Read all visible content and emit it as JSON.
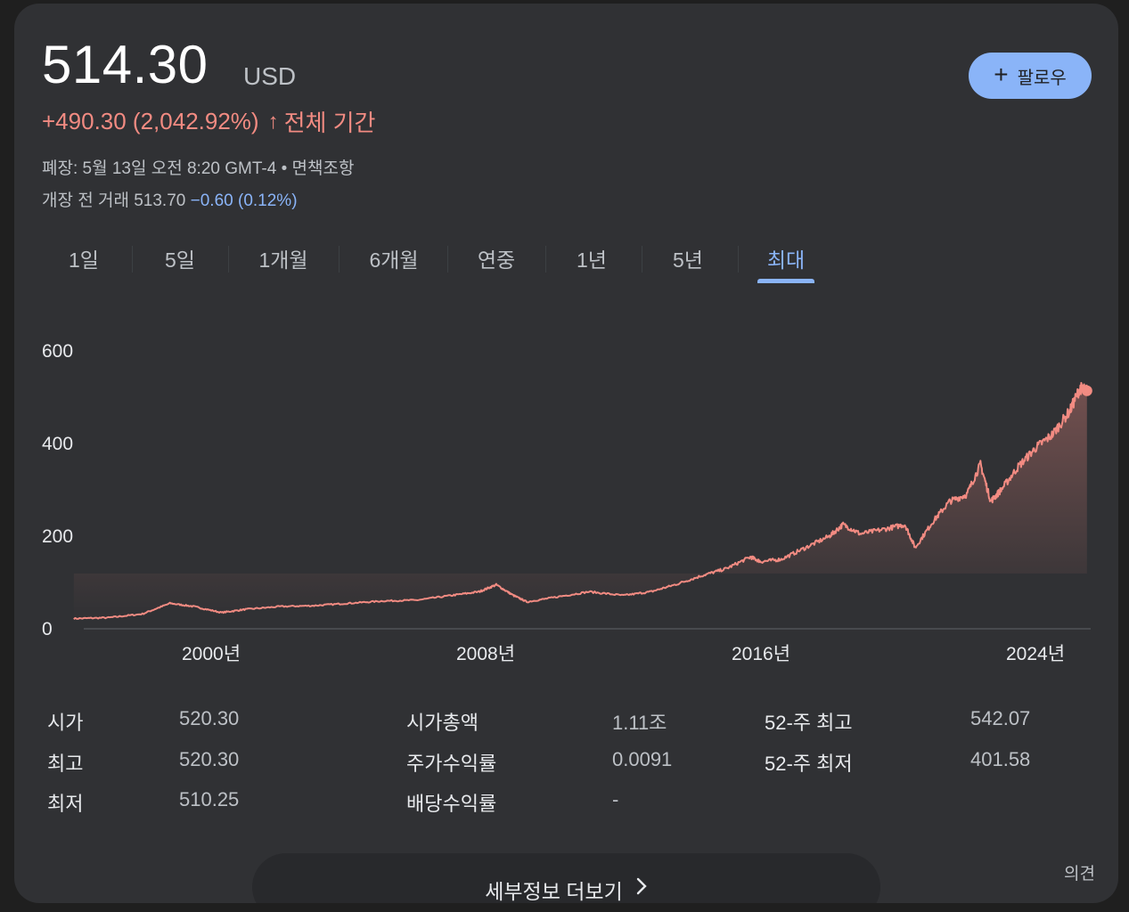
{
  "quote": {
    "price": "514.30",
    "currency": "USD",
    "change": "+490.30 (2,042.92%)",
    "change_arrow": "↑",
    "period_label": "전체 기간",
    "close_info": "폐장: 5월 13일 오전 8:20 GMT-4 • 면책조항",
    "premarket_label": "개장 전 거래 513.70",
    "premarket_change": "−0.60 (0.12%)"
  },
  "follow_button": {
    "icon": "plus-icon",
    "label": "팔로우"
  },
  "tabs": [
    {
      "label": "1일"
    },
    {
      "label": "5일"
    },
    {
      "label": "1개월"
    },
    {
      "label": "6개월"
    },
    {
      "label": "연중"
    },
    {
      "label": "1년"
    },
    {
      "label": "5년"
    },
    {
      "label": "최대",
      "active": true
    }
  ],
  "chart_data": {
    "type": "area",
    "color": "#f28b82",
    "ylim": [
      0,
      600
    ],
    "y_ticks": [
      "600",
      "400",
      "200",
      "0"
    ],
    "x_ticks": [
      "2000년",
      "2008년",
      "2016년",
      "2024년"
    ],
    "x": [
      1996.0,
      1997.0,
      1998.0,
      1998.8,
      1999.5,
      2000.3,
      2001.0,
      2002.0,
      2003.0,
      2004.0,
      2005.0,
      2006.0,
      2007.0,
      2007.8,
      2008.3,
      2008.8,
      2009.2,
      2010.0,
      2011.0,
      2012.0,
      2012.8,
      2013.5,
      2014.3,
      2015.0,
      2015.7,
      2016.0,
      2016.6,
      2017.3,
      2018.0,
      2018.4,
      2018.9,
      2019.6,
      2020.2,
      2020.5,
      2021.0,
      2021.5,
      2022.0,
      2022.4,
      2022.7,
      2023.0,
      2023.5,
      2024.0,
      2024.5,
      2025.0,
      2025.3,
      2025.5
    ],
    "y": [
      22,
      24,
      32,
      55,
      48,
      35,
      42,
      48,
      50,
      55,
      60,
      62,
      72,
      80,
      95,
      72,
      58,
      68,
      80,
      72,
      80,
      95,
      115,
      130,
      155,
      145,
      150,
      175,
      200,
      225,
      205,
      215,
      225,
      175,
      230,
      275,
      290,
      355,
      275,
      300,
      350,
      390,
      420,
      470,
      520,
      514
    ]
  },
  "stats": [
    {
      "label": "시가",
      "value": "520.30"
    },
    {
      "label": "최고",
      "value": "520.30"
    },
    {
      "label": "최저",
      "value": "510.25"
    },
    {
      "label": "시가총액",
      "value": "1.11조"
    },
    {
      "label": "주가수익률",
      "value": "0.0091"
    },
    {
      "label": "배당수익률",
      "value": "-"
    },
    {
      "label": "52-주 최고",
      "value": "542.07"
    },
    {
      "label": "52-주 최저",
      "value": "401.58"
    }
  ],
  "more_button": {
    "label": "세부정보 더보기",
    "icon": "chevron-right-icon"
  },
  "feedback": "의견"
}
